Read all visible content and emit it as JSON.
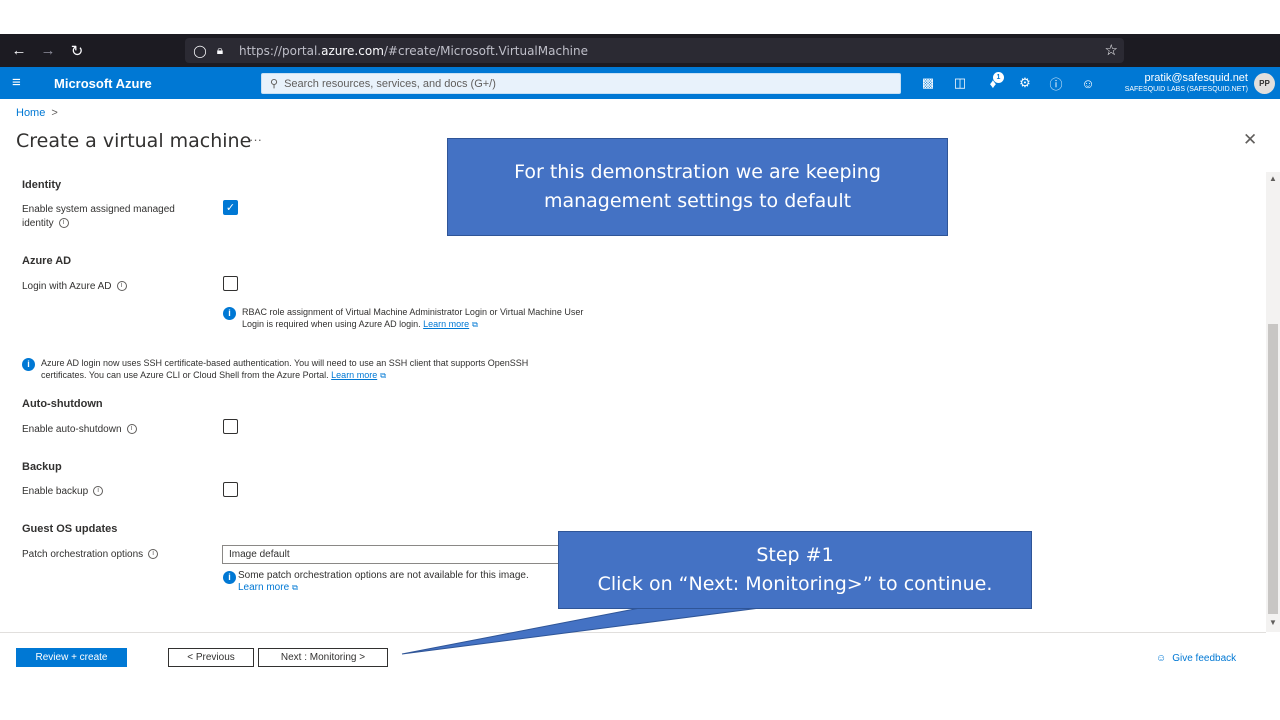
{
  "browser": {
    "url_prefix": "https://portal.",
    "url_domain": "azure.com",
    "url_rest": "/#create/Microsoft.VirtualMachine",
    "profile_initial": "P"
  },
  "azure": {
    "brand": "Microsoft Azure",
    "search_placeholder": "Search resources, services, and docs (G+/)",
    "notification_count": "1",
    "account_email": "pratik@safesquid.net",
    "account_org": "SAFESQUID LABS (SAFESQUID.NET)",
    "avatar_initials": "PP",
    "accent_color": "#0078d4"
  },
  "breadcrumb": {
    "home": "Home",
    "separator": ">"
  },
  "page": {
    "title": "Create a virtual machine",
    "more": "···",
    "close": "✕"
  },
  "identity": {
    "heading": "Identity",
    "label": "Enable system assigned managed identity",
    "checked": true
  },
  "azure_ad": {
    "heading": "Azure AD",
    "label": "Login with Azure AD",
    "checked": false,
    "rbac_note": "RBAC role assignment of Virtual Machine Administrator Login or Virtual Machine User Login is required when using Azure AD login.",
    "rbac_link": "Learn more",
    "ssh_note": "Azure AD login now uses SSH certificate-based authentication. You will need to use an SSH client that supports OpenSSH certificates. You can use Azure CLI or Cloud Shell from the Azure Portal.",
    "ssh_link": "Learn more"
  },
  "auto_shutdown": {
    "heading": "Auto-shutdown",
    "label": "Enable auto-shutdown",
    "checked": false
  },
  "backup": {
    "heading": "Backup",
    "label": "Enable backup",
    "checked": false
  },
  "guest_os": {
    "heading": "Guest OS updates",
    "label": "Patch orchestration options",
    "selected": "Image default",
    "note": "Some patch orchestration options are not available for this image.",
    "link": "Learn more"
  },
  "footer": {
    "review_create": "Review + create",
    "previous": "< Previous",
    "next": "Next : Monitoring >",
    "feedback": "Give feedback"
  },
  "callouts": {
    "top_line1": "For this demonstration we are keeping",
    "top_line2": "management settings to default",
    "step_title": "Step #1",
    "step_text": "Click on “Next: Monitoring>” to continue."
  }
}
